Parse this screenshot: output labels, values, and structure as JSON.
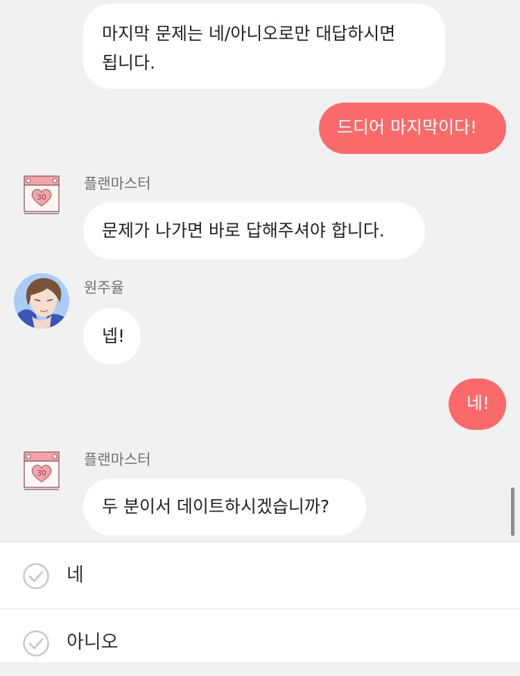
{
  "messages": [
    {
      "sender": "",
      "text_line1": "마지막 문제는 네/아니오로만 대답하시면",
      "text_line2": "됩니다."
    },
    {
      "sender": "user",
      "text": "드디어 마지막이다!"
    },
    {
      "sender": "플랜마스터",
      "avatar_label": "30",
      "text": "문제가 나가면 바로 답해주셔야 합니다."
    },
    {
      "sender": "원주율",
      "text": "넵!"
    },
    {
      "sender": "user",
      "text": "네!"
    },
    {
      "sender": "플랜마스터",
      "avatar_label": "30",
      "text": "두 분이서 데이트하시겠습니까?"
    }
  ],
  "options": [
    {
      "label": "네"
    },
    {
      "label": "아니오"
    }
  ],
  "colors": {
    "user_bubble": "#fa6a6a",
    "other_bubble": "#ffffff",
    "background": "#f1f1f1",
    "calendar_pink": "#f5a3a8"
  }
}
